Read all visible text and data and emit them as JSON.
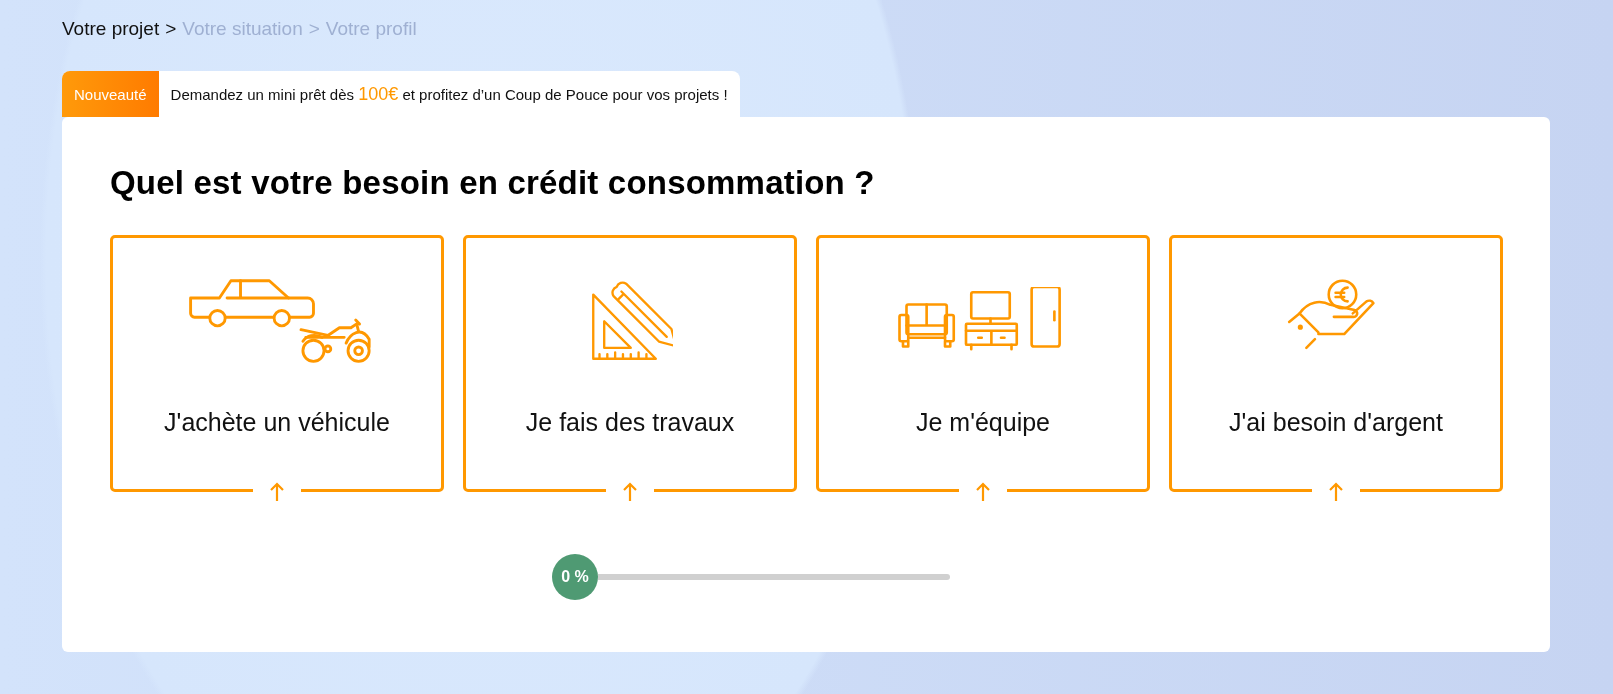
{
  "breadcrumb": [
    {
      "label": "Votre projet",
      "active": true
    },
    {
      "separator": ">",
      "label": "Votre situation",
      "active": false
    },
    {
      "separator": ">",
      "label": "Votre profil",
      "active": false
    }
  ],
  "banner": {
    "badge": "Nouveauté",
    "text": "Demandez un mini prêt dès **100€** et profitez d’un Coup de Pouce pour vos projets !"
  },
  "question": {
    "title": "Quel est votre besoin en crédit consommation ?",
    "options": [
      {
        "kind": "vehicle",
        "label": "J'achète un véhicule"
      },
      {
        "kind": "works",
        "label": "Je fais des travaux"
      },
      {
        "kind": "equipment",
        "label": "Je m'équipe"
      },
      {
        "kind": "money",
        "label": "J'ai besoin d'argent"
      }
    ]
  },
  "progress": {
    "label": "0 %",
    "level": 0
  }
}
